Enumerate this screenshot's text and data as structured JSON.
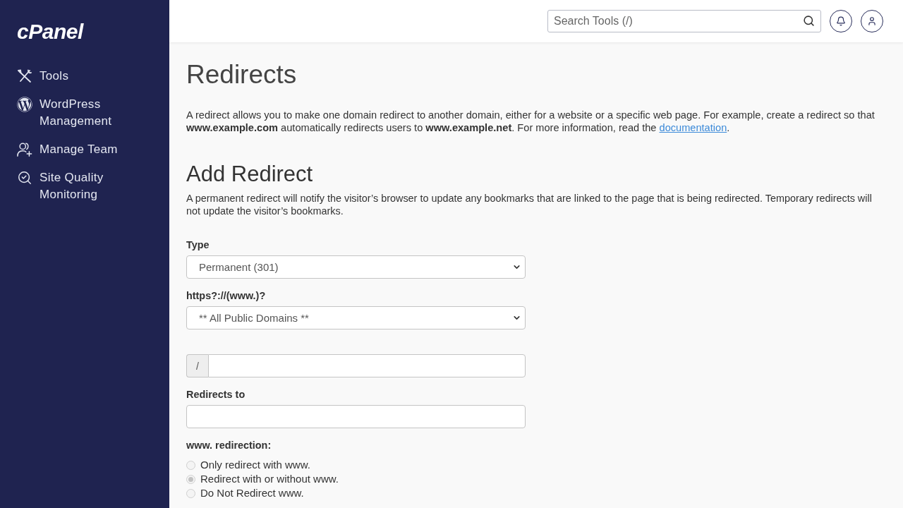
{
  "sidebar": {
    "logo": "cPanel",
    "items": [
      {
        "kind": "tools",
        "label": "Tools",
        "selected": false
      },
      {
        "kind": "wordpress",
        "label": "WordPress Management",
        "selected": false
      },
      {
        "kind": "team",
        "label": "Manage Team",
        "selected": false
      },
      {
        "kind": "quality",
        "label": "Site Quality Monitoring",
        "selected": false
      }
    ]
  },
  "header": {
    "search": {
      "placeholder": "Search Tools (/)"
    }
  },
  "page": {
    "title": "Redirects",
    "intro": {
      "text": "A redirect allows you to make one domain redirect to another domain, either for a website or a specific web page. For example, create a redirect so that **www.example.com** automatically redirects users to **www.example.net**. For more information, read the ",
      "link": "documentation",
      "after": "."
    }
  },
  "add_redirect": {
    "title": "Add Redirect",
    "description": "A permanent redirect will notify the visitor’s browser to update any bookmarks that are linked to the page that is being redirected. Temporary redirects will not update the visitor’s bookmarks.",
    "fields": [
      {
        "kind": "select",
        "label": "Type",
        "value": "Permanent (301)"
      },
      {
        "kind": "select",
        "label": "https?://(www.)?",
        "value": "** All Public Domains **"
      },
      {
        "kind": "path",
        "prefix": "/"
      },
      {
        "kind": "text",
        "label": "Redirects to"
      }
    ],
    "www_redirection": {
      "label": "www. redirection:",
      "disabled": true,
      "options": [
        {
          "label": "Only redirect with www.",
          "selected": false
        },
        {
          "label": "Redirect with or without www.",
          "selected": true
        },
        {
          "label": "Do Not Redirect www.",
          "selected": false
        }
      ]
    }
  }
}
